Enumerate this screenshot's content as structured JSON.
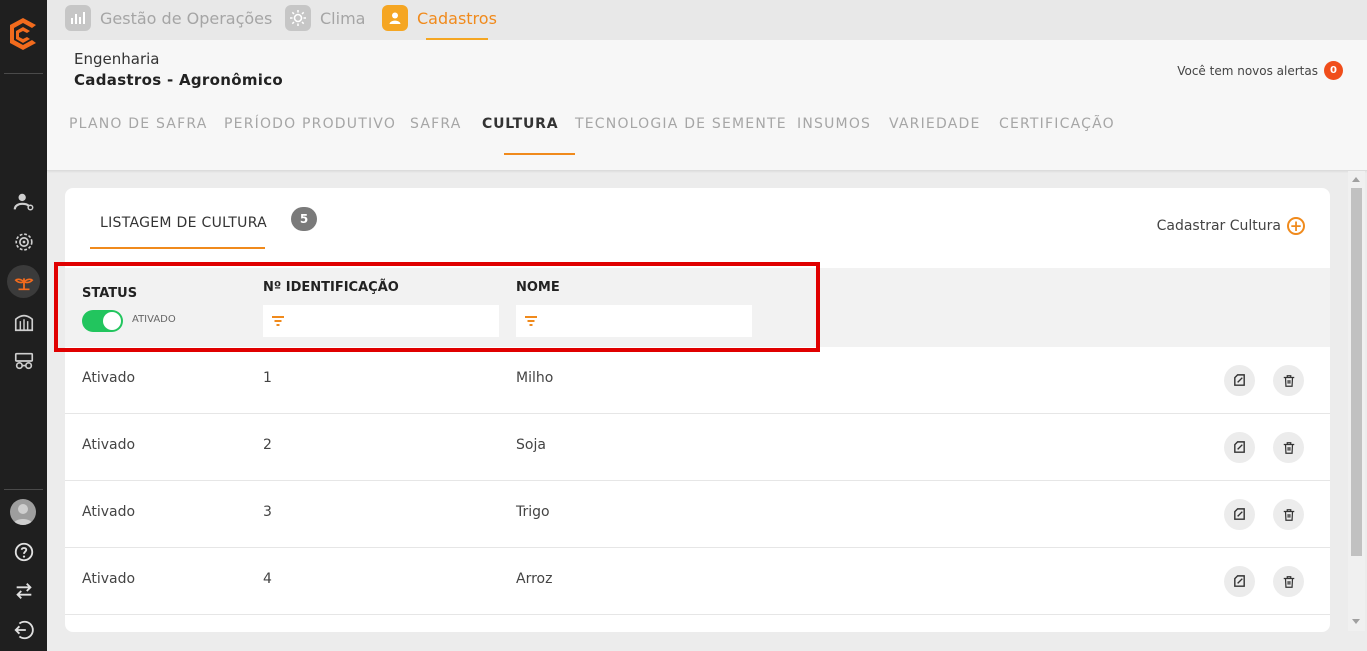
{
  "topbar": {
    "modules": [
      {
        "label": "Gestão de Operações",
        "icon": "operations-icon"
      },
      {
        "label": "Clima",
        "icon": "sun-icon"
      },
      {
        "label": "Cadastros",
        "icon": "user-icon"
      }
    ],
    "active_module": "Cadastros"
  },
  "header": {
    "breadcrumb_parent": "Engenharia",
    "breadcrumb_current": "Cadastros - Agronômico",
    "alerts_text": "Você tem novos alertas",
    "alerts_count": "0"
  },
  "tabs": [
    {
      "label": "PLANO DE SAFRA"
    },
    {
      "label": "PERÍODO PRODUTIVO"
    },
    {
      "label": "SAFRA"
    },
    {
      "label": "CULTURA"
    },
    {
      "label": "TECNOLOGIA DE SEMENTE"
    },
    {
      "label": "INSUMOS"
    },
    {
      "label": "VARIEDADE"
    },
    {
      "label": "CERTIFICAÇÃO"
    }
  ],
  "active_tab": "CULTURA",
  "list": {
    "title": "LISTAGEM DE CULTURA",
    "count": "5",
    "add_label": "Cadastrar Cultura"
  },
  "filters": {
    "status_header": "STATUS",
    "status_toggle_label": "ATIVADO",
    "status_on": true,
    "id_header": "Nº IDENTIFICAÇÃO",
    "name_header": "NOME",
    "id_value": "",
    "name_value": ""
  },
  "rows": [
    {
      "status": "Ativado",
      "id": "1",
      "name": "Milho"
    },
    {
      "status": "Ativado",
      "id": "2",
      "name": "Soja"
    },
    {
      "status": "Ativado",
      "id": "3",
      "name": "Trigo"
    },
    {
      "status": "Ativado",
      "id": "4",
      "name": "Arroz"
    }
  ],
  "colors": {
    "accent": "#f08a1c",
    "active_module": "#f5a623",
    "toggle_on": "#22c55e",
    "highlight": "#e00000",
    "alert_badge": "#f04d1a"
  }
}
